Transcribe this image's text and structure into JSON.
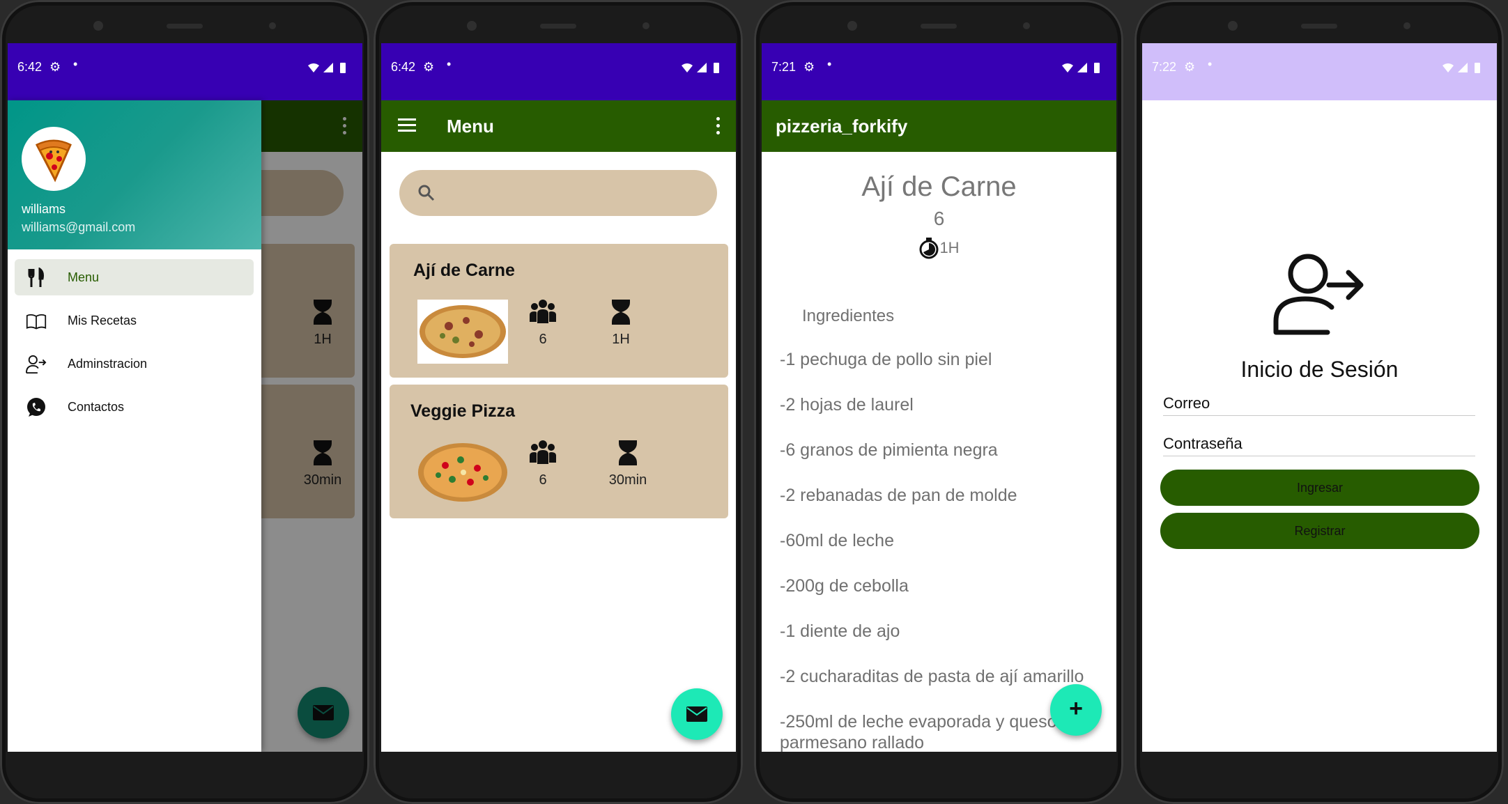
{
  "colors": {
    "primary_dark": "#3700b3",
    "app_bar": "#275c00",
    "card": "#d7c4a8",
    "fab": "#1de9b6",
    "drawer_header": "#009688"
  },
  "phone1": {
    "status_time": "6:42",
    "drawer": {
      "user_name": "williams",
      "user_email": "williams@gmail.com",
      "items": [
        {
          "label": "Menu",
          "icon": "utensils-icon",
          "active": true
        },
        {
          "label": "Mis Recetas",
          "icon": "book-icon",
          "active": false
        },
        {
          "label": "Adminstracion",
          "icon": "login-icon",
          "active": false
        },
        {
          "label": "Contactos",
          "icon": "whatsapp-icon",
          "active": false
        }
      ]
    },
    "behind": {
      "time1": "1H",
      "time2": "30min"
    }
  },
  "phone2": {
    "status_time": "6:42",
    "app_bar_title": "Menu",
    "search_placeholder": "",
    "recipes": [
      {
        "name": "Ají de Carne",
        "servings": "6",
        "time": "1H"
      },
      {
        "name": "Veggie Pizza",
        "servings": "6",
        "time": "30min"
      }
    ]
  },
  "phone3": {
    "status_time": "7:21",
    "app_bar_title": "pizzeria_forkify",
    "recipe_name": "Ají de Carne",
    "servings": "6",
    "time": "1H",
    "ingredients_heading": "Ingredientes",
    "ingredients": [
      "-1 pechuga de pollo sin piel",
      "-2 hojas de laurel",
      "-6 granos de pimienta negra",
      "-2 rebanadas de pan de molde",
      "-60ml de leche",
      "-200g de cebolla",
      "-1 diente de ajo",
      "-2 cucharaditas de pasta de ají amarillo",
      "-250ml de leche evaporada y queso",
      "parmesano rallado"
    ],
    "fab_label": "+"
  },
  "phone4": {
    "status_time": "7:22",
    "title": "Inicio de Sesión",
    "email_label": "Correo",
    "password_label": "Contraseña",
    "login_button": "Ingresar",
    "register_button": "Registrar"
  }
}
